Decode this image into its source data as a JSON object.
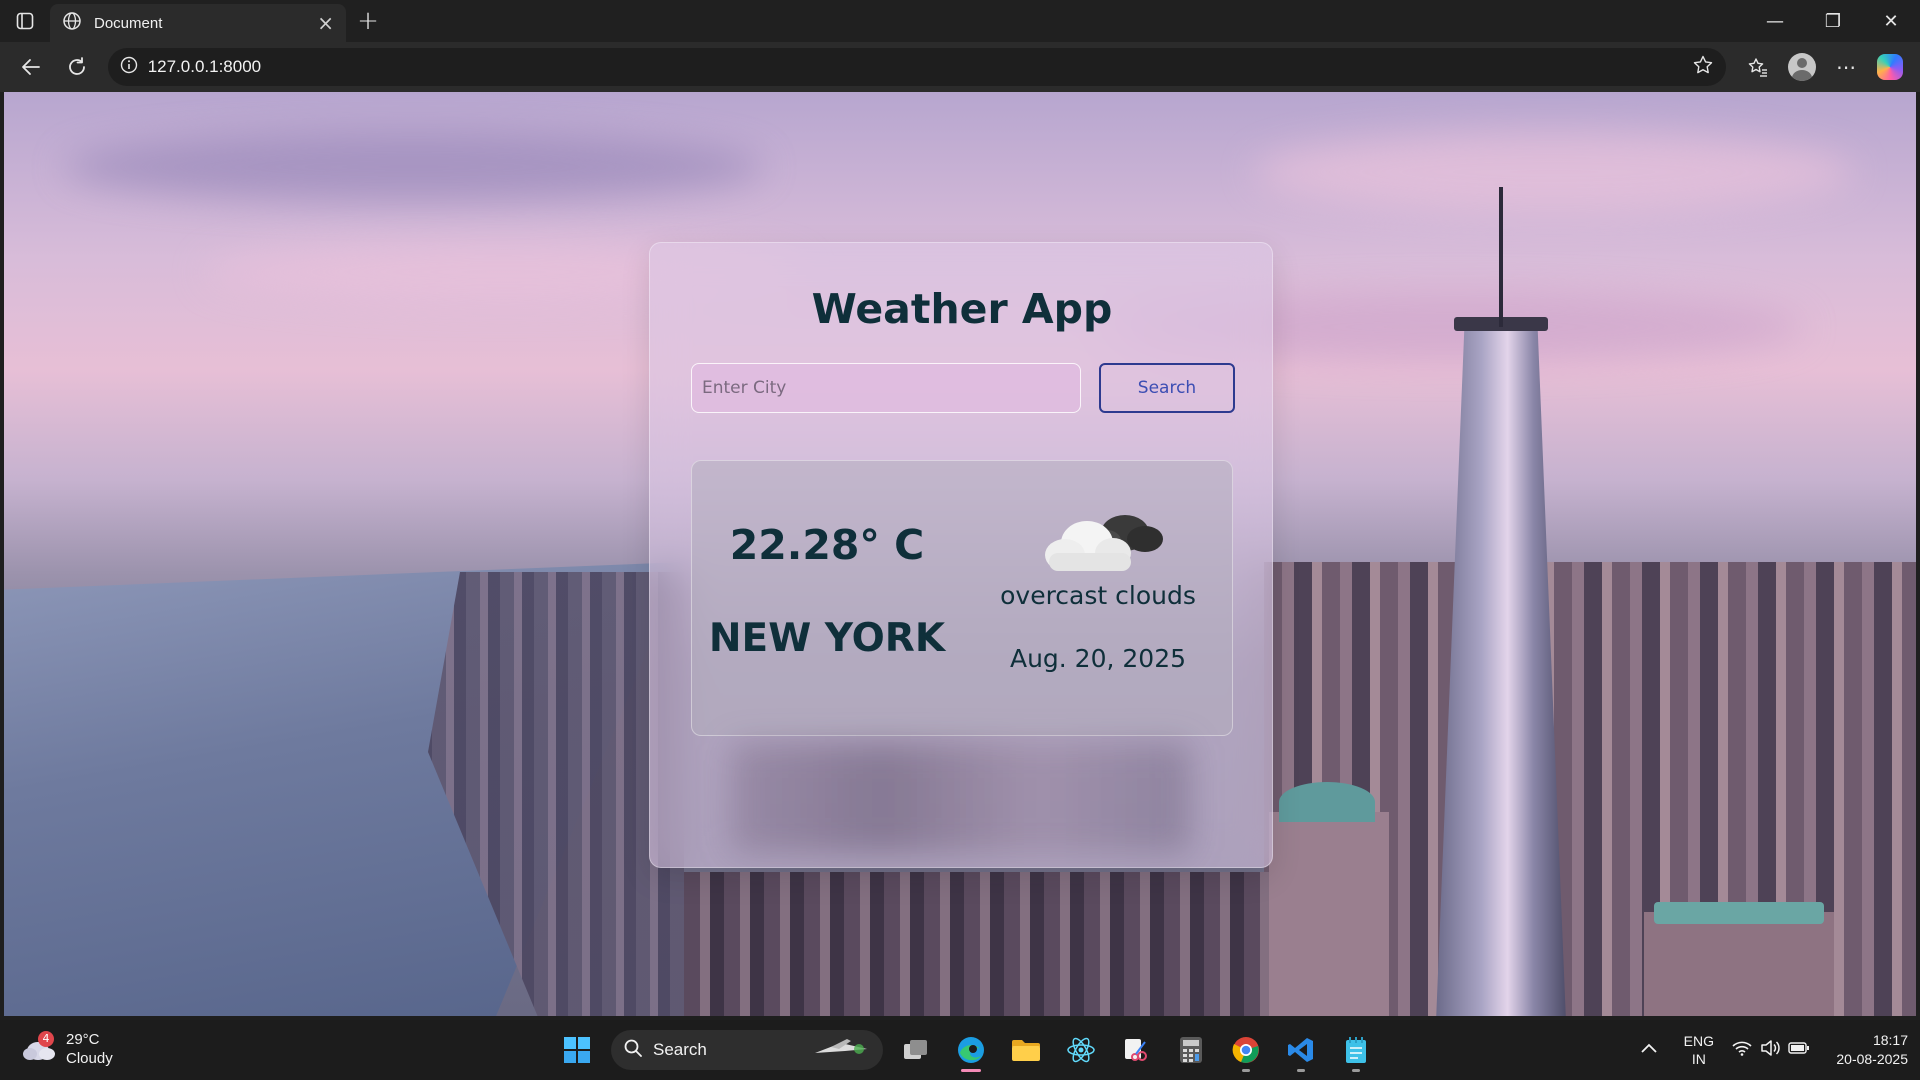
{
  "browser": {
    "tab_title": "Document",
    "url": "127.0.0.1:8000"
  },
  "app": {
    "title": "Weather App",
    "search": {
      "placeholder": "Enter City",
      "value": "",
      "button_label": "Search"
    },
    "weather": {
      "temperature": "22.28° C",
      "city": "NEW YORK",
      "description": "overcast clouds",
      "date": "Aug. 20, 2025",
      "icon": "overcast-clouds-icon"
    }
  },
  "taskbar": {
    "weather_temp": "29°C",
    "weather_desc": "Cloudy",
    "weather_badge": "4",
    "search_label": "Search",
    "lang_line1": "ENG",
    "lang_line2": "IN",
    "time": "18:17",
    "date": "20-08-2025"
  },
  "colors": {
    "heading": "#0f2f3a",
    "button_border": "#2d3a8f",
    "button_text": "#3b4db3",
    "taskbar_bg": "#1c1c1c",
    "chrome_bg": "#202020"
  }
}
